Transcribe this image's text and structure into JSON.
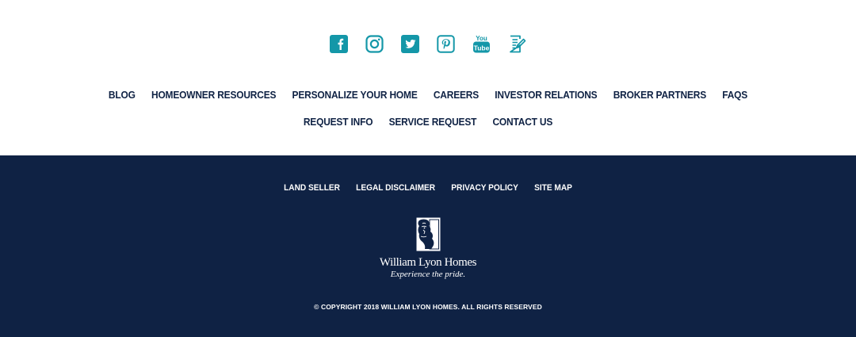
{
  "social": {
    "icons": [
      {
        "name": "facebook-icon"
      },
      {
        "name": "instagram-icon"
      },
      {
        "name": "twitter-icon"
      },
      {
        "name": "pinterest-icon"
      },
      {
        "name": "youtube-icon",
        "label_top": "You",
        "label_bottom": "Tube"
      },
      {
        "name": "blog-edit-icon"
      }
    ],
    "color": "#1497a8"
  },
  "nav": {
    "row1": [
      "BLOG",
      "HOMEOWNER RESOURCES",
      "PERSONALIZE YOUR HOME",
      "CAREERS",
      "INVESTOR RELATIONS",
      "BROKER PARTNERS",
      "FAQS"
    ],
    "row2": [
      "REQUEST INFO",
      "SERVICE REQUEST",
      "CONTACT US"
    ]
  },
  "legal": {
    "links": [
      "LAND SELLER",
      "LEGAL DISCLAIMER",
      "PRIVACY POLICY",
      "SITE MAP"
    ]
  },
  "brand": {
    "name": "William Lyon Homes",
    "tagline": "Experience the pride."
  },
  "footer": {
    "copyright": "© COPYRIGHT 2018 WILLIAM LYON HOMES. ALL RIGHTS RESERVED"
  },
  "colors": {
    "navy": "#0f2244",
    "teal": "#1497a8",
    "white": "#ffffff"
  }
}
